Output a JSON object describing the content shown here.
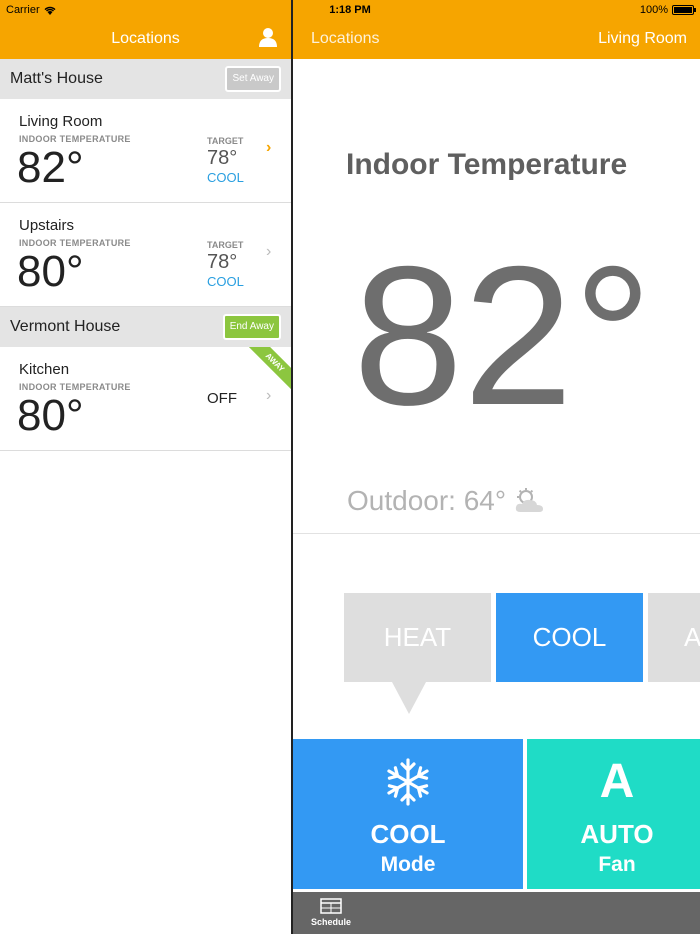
{
  "status_bar": {
    "carrier": "Carrier",
    "time": "1:18 PM",
    "battery": "100%"
  },
  "nav": {
    "left_title": "Locations",
    "back_label": "Locations",
    "right_title": "Living Room"
  },
  "colors": {
    "accent": "#f6a500",
    "cool": "#3399f3",
    "fan": "#1fdcc6",
    "away": "#8cc63f",
    "mode_text": "#2a9fe0"
  },
  "groups": [
    {
      "name": "Matt's House",
      "away_button": "Set Away",
      "locations": [
        {
          "room": "Living Room",
          "indoor_label": "INDOOR TEMPERATURE",
          "temp": "82°",
          "target_label": "TARGET",
          "target": "78°",
          "mode": "COOL"
        },
        {
          "room": "Upstairs",
          "indoor_label": "INDOOR TEMPERATURE",
          "temp": "80°",
          "target_label": "TARGET",
          "target": "78°",
          "mode": "COOL"
        }
      ]
    },
    {
      "name": "Vermont House",
      "away_button": "End Away",
      "locations": [
        {
          "room": "Kitchen",
          "indoor_label": "INDOOR TEMPERATURE",
          "temp": "80°",
          "status": "OFF",
          "ribbon": "AWAY"
        }
      ]
    }
  ],
  "detail": {
    "title": "Indoor Temperature",
    "temp": "82°",
    "outdoor": "Outdoor: 64°",
    "weather_icon": "partly-cloudy-icon",
    "modes": [
      "HEAT",
      "COOL",
      "A"
    ],
    "mode_tile": {
      "value": "COOL",
      "label": "Mode",
      "icon": "snowflake-icon"
    },
    "fan_tile": {
      "letter": "A",
      "value": "AUTO",
      "label": "Fan"
    },
    "schedule_label": "Schedule"
  }
}
